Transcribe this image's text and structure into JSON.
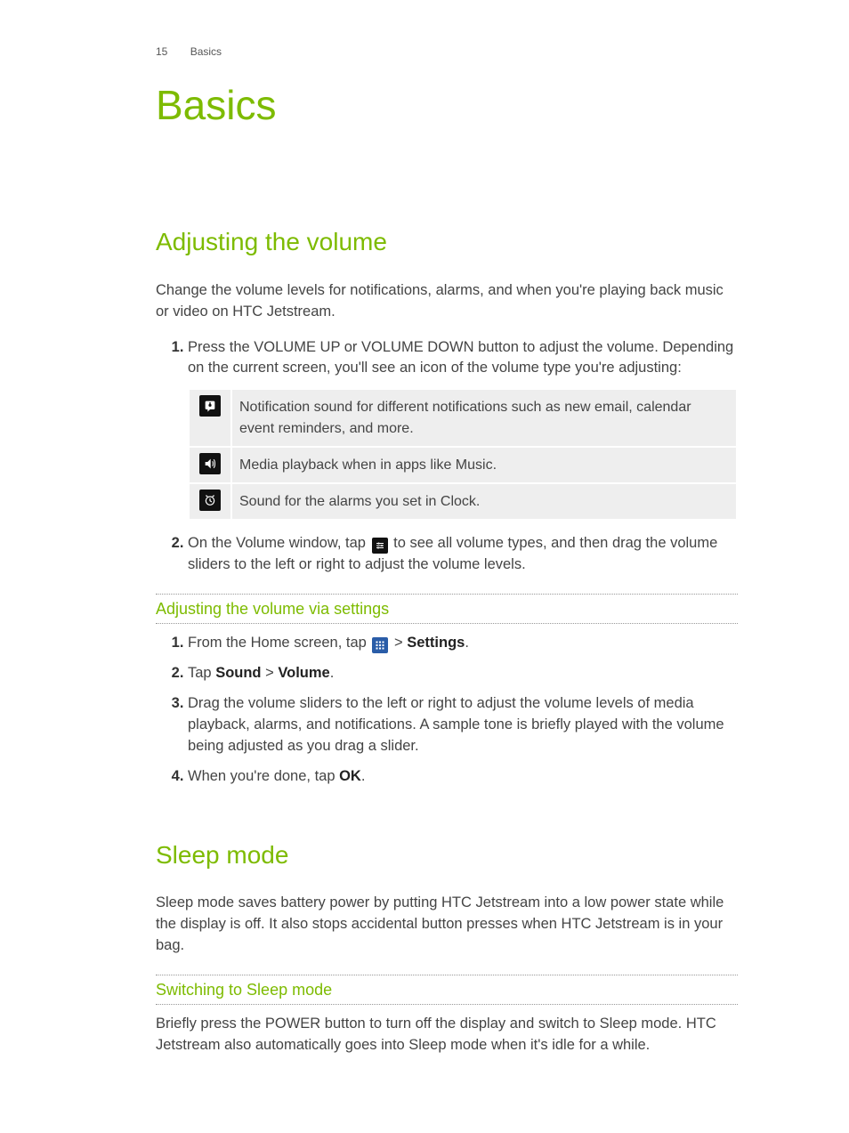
{
  "header": {
    "page_number": "15",
    "section": "Basics"
  },
  "chapter_title": "Basics",
  "sections": {
    "adjust_volume": {
      "title": "Adjusting the volume",
      "intro": "Change the volume levels for notifications, alarms, and when you're playing back music or video on HTC Jetstream.",
      "steps": {
        "s1": "Press the VOLUME UP or VOLUME DOWN button to adjust the volume. Depending on the current screen, you'll see an icon of the volume type you're adjusting:",
        "s2_pre": "On the Volume window, tap ",
        "s2_post": " to see all volume types, and then drag the volume sliders to the left or right to adjust the volume levels."
      },
      "table": {
        "r1": "Notification sound for different notifications such as new email, calendar event reminders, and more.",
        "r2": "Media playback when in apps like Music.",
        "r3": "Sound for the alarms you set in Clock."
      },
      "sub": {
        "title": "Adjusting the volume via settings",
        "steps": {
          "s1_pre": "From the Home screen, tap ",
          "s1_mid": " > ",
          "s1_bold": "Settings",
          "s1_post": ".",
          "s2_a": "Tap ",
          "s2_b": "Sound",
          "s2_c": " > ",
          "s2_d": "Volume",
          "s2_e": ".",
          "s3": "Drag the volume sliders to the left or right to adjust the volume levels of media playback, alarms, and notifications. A sample tone is briefly played with the volume being adjusted as you drag a slider.",
          "s4_a": "When you're done, tap ",
          "s4_b": "OK",
          "s4_c": "."
        }
      }
    },
    "sleep_mode": {
      "title": "Sleep mode",
      "intro": "Sleep mode saves battery power by putting HTC Jetstream into a low power state while the display is off. It also stops accidental button presses when HTC Jetstream is in your bag.",
      "sub": {
        "title": "Switching to Sleep mode",
        "body": "Briefly press the POWER button to turn off the display and switch to Sleep mode. HTC Jetstream also automatically goes into Sleep mode when it's idle for a while."
      }
    }
  }
}
